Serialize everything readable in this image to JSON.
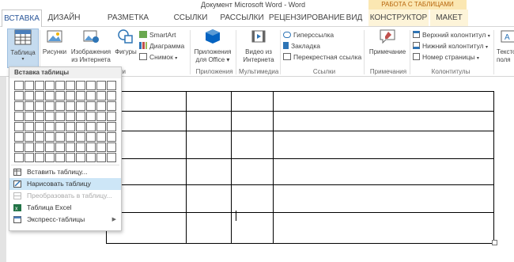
{
  "window": {
    "title": "Документ Microsoft Word - Word",
    "context_group": "РАБОТА С ТАБЛИЦАМИ"
  },
  "tabs": [
    {
      "label": "ВСТАВКА"
    },
    {
      "label": "ДИЗАЙН"
    },
    {
      "label": "РАЗМЕТКА СТРАНИЦЫ"
    },
    {
      "label": "ССЫЛКИ"
    },
    {
      "label": "РАССЫЛКИ"
    },
    {
      "label": "РЕЦЕНЗИРОВАНИЕ"
    },
    {
      "label": "ВИД"
    },
    {
      "label": "КОНСТРУКТОР"
    },
    {
      "label": "МАКЕТ"
    }
  ],
  "ribbon": {
    "table_btn": "Таблица",
    "pictures_btn": "Рисунки",
    "online_pictures_btn_1": "Изображения",
    "online_pictures_btn_2": "из Интернета",
    "shapes_btn": "Фигуры",
    "smartart": "SmartArt",
    "chart": "Диаграмма",
    "screenshot": "Снимок",
    "illustrations_group": "иллюстрации",
    "apps_btn_1": "Приложения",
    "apps_btn_2": "для Office",
    "apps_group": "Приложения",
    "video_btn_1": "Видео из",
    "video_btn_2": "Интернета",
    "media_group": "Мультимедиа",
    "hyperlink": "Гиперссылка",
    "bookmark": "Закладка",
    "crossref": "Перекрестная ссылка",
    "links_group": "Ссылки",
    "comment_btn": "Примечание",
    "comments_group": "Примечания",
    "header": "Верхний колонтитул",
    "footer": "Нижний колонтитул",
    "pagenum": "Номер страницы",
    "hf_group": "Колонтитулы",
    "text_btn_1": "Тексто",
    "text_btn_2": "поля"
  },
  "menu": {
    "header": "Вставка таблицы",
    "grid_cols": 10,
    "grid_rows": 8,
    "items": [
      {
        "label": "Вставить таблицу...",
        "state": "normal"
      },
      {
        "label": "Нарисовать таблицу",
        "state": "highlighted"
      },
      {
        "label": "Преобразовать в таблицу...",
        "state": "disabled"
      },
      {
        "label": "Таблица Excel",
        "state": "normal"
      },
      {
        "label": "Экспресс-таблицы",
        "state": "normal"
      }
    ]
  },
  "document": {
    "table_rows": 6,
    "table_cols": 4
  },
  "colors": {
    "accent": "#2b579a",
    "context_tab": "#fbe7b2",
    "highlight": "#cde6f7"
  }
}
